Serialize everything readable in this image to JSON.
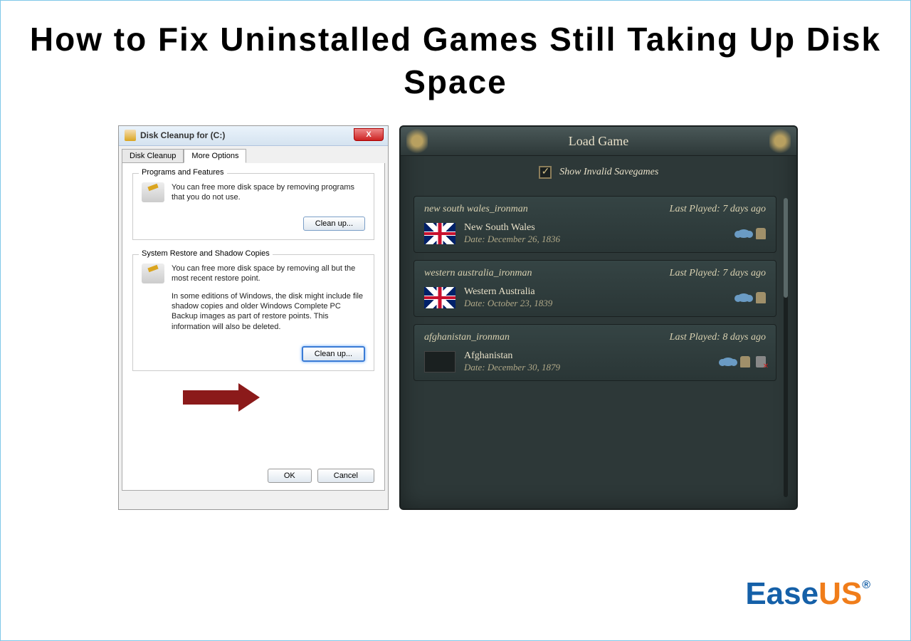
{
  "page": {
    "title": "How to Fix Uninstalled Games Still Taking Up Disk Space"
  },
  "disk_cleanup": {
    "window_title": "Disk Cleanup for  (C:)",
    "close_label": "X",
    "tabs": [
      "Disk Cleanup",
      "More Options"
    ],
    "active_tab": 1,
    "groups": [
      {
        "title": "Programs and Features",
        "text1": "You can free more disk space by removing programs that you do not use.",
        "button": "Clean up..."
      },
      {
        "title": "System Restore and Shadow Copies",
        "text1": "You can free more disk space by removing all but the most recent restore point.",
        "text2": "In some editions of Windows, the disk might include file shadow copies and older Windows Complete PC Backup images as part of restore points. This information will also be deleted.",
        "button": "Clean up..."
      }
    ],
    "ok_label": "OK",
    "cancel_label": "Cancel"
  },
  "game_panel": {
    "title": "Load Game",
    "checkbox_label": "Show Invalid Savegames",
    "saves": [
      {
        "filename": "new south wales_ironman",
        "last_played": "Last Played: 7 days ago",
        "country": "New South Wales",
        "date": "Date: December 26, 1836",
        "flag": "uk",
        "has_trophy": false
      },
      {
        "filename": "western australia_ironman",
        "last_played": "Last Played: 7 days ago",
        "country": "Western Australia",
        "date": "Date: October 23, 1839",
        "flag": "uk",
        "has_trophy": false
      },
      {
        "filename": "afghanistan_ironman",
        "last_played": "Last Played: 8 days ago",
        "country": "Afghanistan",
        "date": "Date: December 30, 1879",
        "flag": "blank",
        "has_trophy": true
      }
    ]
  },
  "logo": {
    "part1": "Ease",
    "part2": "US",
    "reg": "®"
  }
}
